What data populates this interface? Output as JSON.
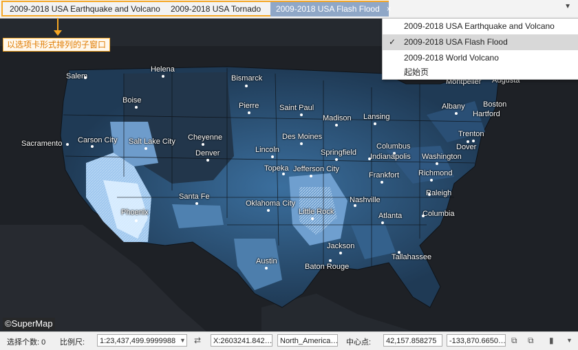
{
  "tabs": [
    {
      "label": "2009-2018 USA Earthquake and Volcano"
    },
    {
      "label": "2009-2018 USA Tornado"
    },
    {
      "label": "2009-2018 USA Flash Flood",
      "close": "×"
    }
  ],
  "callout": "以选项卡形式排列的子窗口",
  "menu": [
    {
      "label": "2009-2018 USA Earthquake and Volcano"
    },
    {
      "label": "2009-2018 USA Flash Flood",
      "check": "✓"
    },
    {
      "label": "2009-2018 World Volcano"
    },
    {
      "label": "起始页"
    }
  ],
  "cities": [
    {
      "label": "Salem"
    },
    {
      "label": "Helena"
    },
    {
      "label": "Bismarck"
    },
    {
      "label": "Montpelier"
    },
    {
      "label": "Augusta"
    },
    {
      "label": "Boise"
    },
    {
      "label": "Pierre"
    },
    {
      "label": "Saint Paul"
    },
    {
      "label": "Madison"
    },
    {
      "label": "Lansing"
    },
    {
      "label": "Albany"
    },
    {
      "label": "Boston"
    },
    {
      "label": "Hartford"
    },
    {
      "label": "Sacramento"
    },
    {
      "label": "Carson City"
    },
    {
      "label": "Cheyenne"
    },
    {
      "label": "Salt Lake City"
    },
    {
      "label": "Des Moines"
    },
    {
      "label": "Trenton"
    },
    {
      "label": "Columbus"
    },
    {
      "label": "Dover"
    },
    {
      "label": "Denver"
    },
    {
      "label": "Lincoln"
    },
    {
      "label": "Springfield"
    },
    {
      "label": "Indianapolis"
    },
    {
      "label": "Washington"
    },
    {
      "label": "Topeka"
    },
    {
      "label": "Jefferson City"
    },
    {
      "label": "Richmond"
    },
    {
      "label": "Frankfort"
    },
    {
      "label": "Santa Fe"
    },
    {
      "label": "Nashville"
    },
    {
      "label": "Raleigh"
    },
    {
      "label": "Oklahoma City"
    },
    {
      "label": "Phoenix"
    },
    {
      "label": "Little Rock"
    },
    {
      "label": "Columbia"
    },
    {
      "label": "Atlanta"
    },
    {
      "label": "Jackson"
    },
    {
      "label": "Tallahassee"
    },
    {
      "label": "Austin"
    },
    {
      "label": "Baton Rouge"
    }
  ],
  "copyright": "©SuperMap",
  "status": {
    "selected_label": "选择个数: 0",
    "scale_label": "比例尺:",
    "scale_value": "1:23,437,499.9999988",
    "x_value": "X:2603241.842…",
    "projection": "North_America…",
    "center_label": "中心点:",
    "center_x": "42,157.858275",
    "center_y": "-133,870.6650…"
  }
}
